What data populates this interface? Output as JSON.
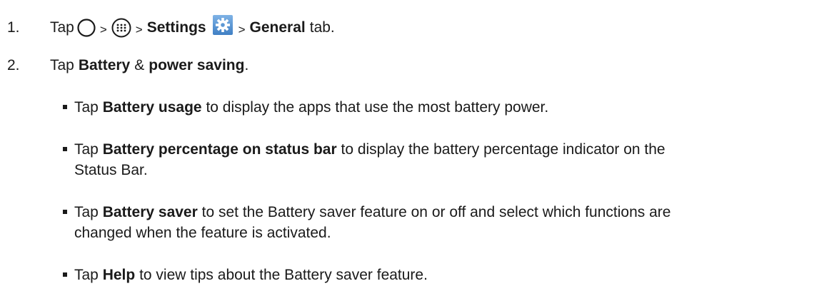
{
  "step1": {
    "number": "1.",
    "tap": "Tap",
    "sep1": ">",
    "sep2": ">",
    "settings": "Settings",
    "sep3": ">",
    "general": "General",
    "tab": "tab.",
    "icons": [
      "home-circle-icon",
      "apps-icon",
      "settings-gear-icon"
    ],
    "settings_icon_color": "#4a90d9"
  },
  "step2": {
    "number": "2.",
    "tap": "Tap",
    "battery": "Battery",
    "amp": "&",
    "power_saving": "power saving",
    "period": "."
  },
  "bullets": [
    {
      "tap": "Tap",
      "bold": "Battery usage",
      "rest": "to display the apps that use the most battery power."
    },
    {
      "tap": "Tap",
      "bold": "Battery percentage on status bar",
      "rest": "to display the battery percentage indicator on the",
      "rest2": "Status Bar."
    },
    {
      "tap": "Tap",
      "bold": "Battery saver",
      "rest": "to set the Battery saver feature on or off and select which functions are",
      "rest2": "changed when the feature is activated."
    },
    {
      "tap": "Tap",
      "bold": "Help",
      "rest": "to view tips about the Battery saver feature."
    }
  ]
}
